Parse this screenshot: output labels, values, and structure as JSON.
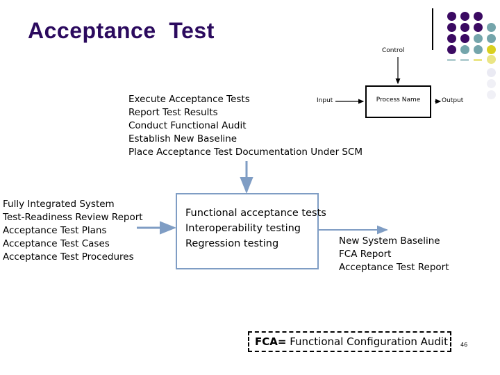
{
  "slide": {
    "title": "Acceptance  Test",
    "page_number": "46",
    "title_color": "#2b0a5e",
    "accent_color": "#7f9dc4"
  },
  "decoration": {
    "name": "dot-grid-decoration",
    "colors": {
      "purple": "#3b0a62",
      "teal": "#74a5ab",
      "yellow": "#d9d020",
      "lavender": "#c9c8e0"
    }
  },
  "idef_diagram": {
    "control_label": "Control",
    "input_label": "Input",
    "process_label": "Process Name",
    "output_label": "Output"
  },
  "top_list": {
    "items": [
      "Execute Acceptance Tests",
      "Report Test Results",
      "Conduct Functional Audit",
      "Establish New Baseline",
      "Place Acceptance Test Documentation Under SCM"
    ]
  },
  "left_list": {
    "items": [
      "Fully Integrated System",
      "Test-Readiness Review Report",
      "Acceptance Test  Plans",
      "Acceptance Test  Cases",
      "Acceptance Test  Procedures"
    ]
  },
  "central_box": {
    "items": [
      "Functional acceptance tests",
      "Interoperability testing",
      "Regression testing"
    ]
  },
  "right_list": {
    "items": [
      "New System Baseline",
      "FCA Report",
      "Acceptance Test Report"
    ]
  },
  "fca_legend": {
    "abbr": "FCA=",
    "expansion": " Functional Configuration Audit"
  }
}
